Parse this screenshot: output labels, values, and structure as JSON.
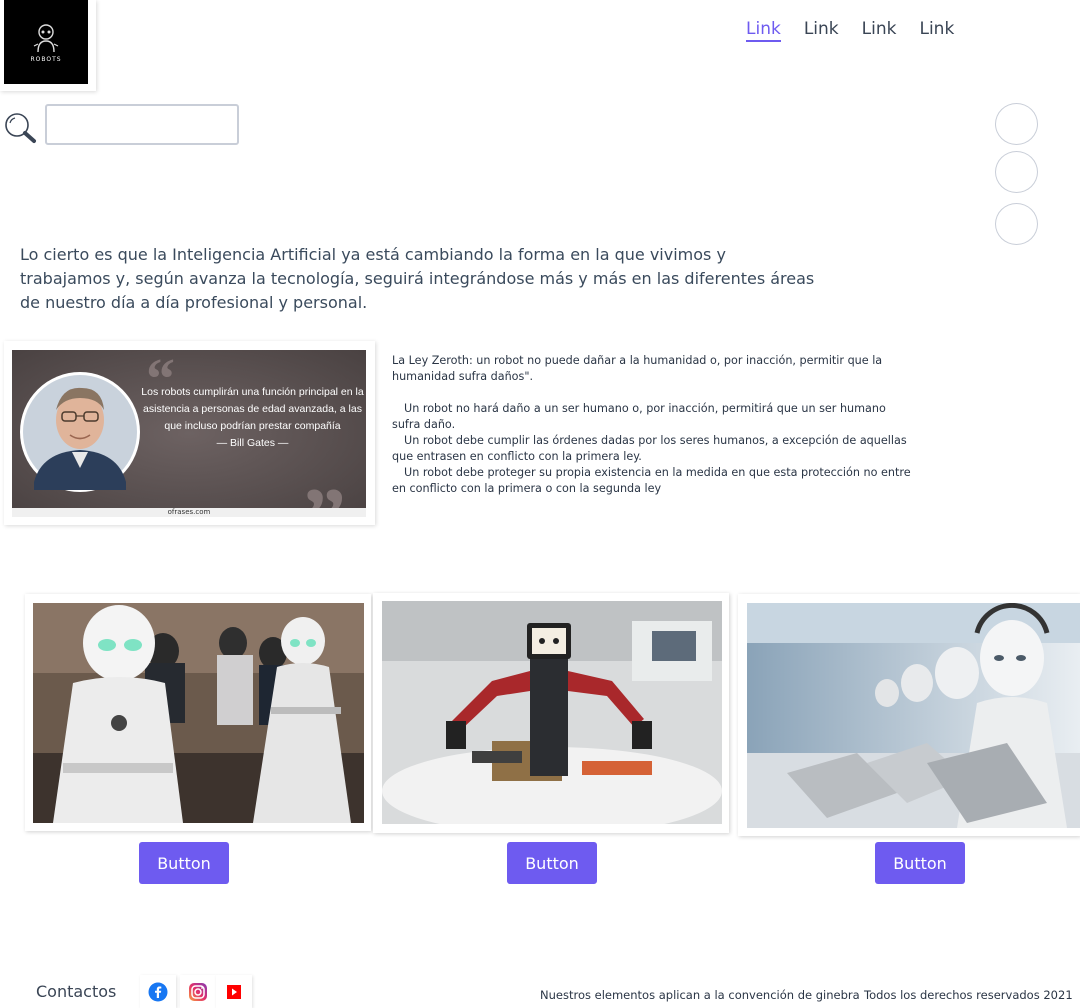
{
  "logo": {
    "text": "ROBOTS"
  },
  "nav": {
    "items": [
      "Link",
      "Link",
      "Link",
      "Link"
    ]
  },
  "search": {
    "value": "",
    "placeholder": ""
  },
  "intro": "Lo cierto es que la Inteligencia Artificial ya está cambiando la forma en la que vivimos y trabajamos y, según avanza la tecnología, seguirá integrándose más y más en las diferentes áreas de nuestro día a día profesional y personal.",
  "quote": {
    "text": "Los robots cumplirán una función principal en la asistencia a personas de edad avanzada, a las que incluso podrían prestar compañía",
    "author": "— Bill Gates —",
    "site": "ofrases.com"
  },
  "laws": {
    "zeroth": "La Ley Zeroth: un robot no puede dañar a la humanidad o, por inacción, permitir que la humanidad sufra daños\".",
    "first": "Un robot no hará daño a un ser humano o, por inacción, permitirá que un ser humano sufra daño.",
    "second": "Un robot debe cumplir las órdenes dadas por los seres humanos, a excepción de aquellas que entrasen en conflicto con la primera ley.",
    "third": "Un robot debe proteger su propia existencia en la medida en que esta protección no entre en conflicto con la primera o con la segunda ley"
  },
  "gallery": {
    "buttons": [
      "Button",
      "Button",
      "Button"
    ]
  },
  "footer": {
    "title": "Contactos",
    "social": [
      "facebook-icon",
      "instagram-icon",
      "youtube-icon"
    ],
    "geneva": "Nuestros elementos aplican a la convención de ginebra",
    "rights": "Todos los derechos reservados 2021"
  },
  "colors": {
    "accent": "#6e5bf0",
    "text": "#2a3545",
    "border": "#c9ced8"
  }
}
